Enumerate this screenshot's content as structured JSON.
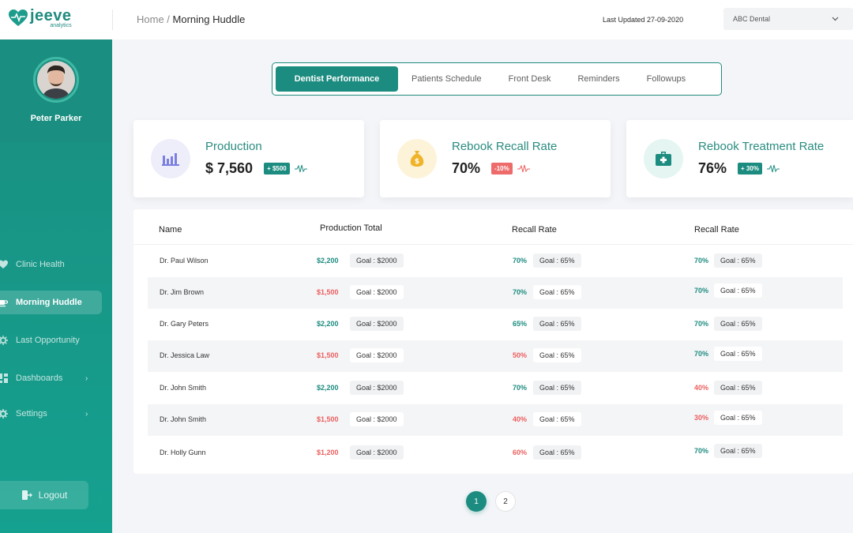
{
  "brand": {
    "name": "jeeve",
    "sub": "analytics",
    "accent": "#1d8c80"
  },
  "breadcrumb": {
    "home": "Home",
    "separator": " / ",
    "current": "Morning Huddle"
  },
  "header": {
    "last_updated": "Last Updated 27-09-2020",
    "clinic": "ABC Dental",
    "clinic_icon": "chevron-down-icon"
  },
  "profile": {
    "name": "Peter Parker"
  },
  "sidebar": {
    "items": [
      {
        "label": "Clinic Health",
        "icon": "heart-pulse-icon"
      },
      {
        "label": "Morning Huddle",
        "icon": "coffee-icon",
        "active": true
      },
      {
        "label": "Last Opportunity",
        "icon": "gear-icon"
      },
      {
        "label": "Dashboards",
        "icon": "dashboard-icon",
        "arrow": "›"
      },
      {
        "label": "Settings",
        "icon": "settings-icon",
        "arrow": "›"
      }
    ],
    "logout": "Logout"
  },
  "tabs": [
    {
      "label": "Dentist Performance",
      "active": true
    },
    {
      "label": "Patients Schedule"
    },
    {
      "label": "Front Desk"
    },
    {
      "label": "Reminders"
    },
    {
      "label": "Followups"
    }
  ],
  "cards": [
    {
      "title": "Production",
      "value": "$ 7,560",
      "badge": "+ $500",
      "trend": "up",
      "icon": "bar-chart-icon",
      "color": "#7b7fe0",
      "bg": "#eeeefb"
    },
    {
      "title": "Rebook Recall Rate",
      "value": "70%",
      "badge": "-10%",
      "trend": "down",
      "icon": "money-bag-icon",
      "color": "#f0b429",
      "bg": "#fdf3d9"
    },
    {
      "title": "Rebook Treatment Rate",
      "value": "76%",
      "badge": "+ 30%",
      "trend": "up",
      "icon": "medkit-icon",
      "color": "#1d8c80",
      "bg": "#e4f5f2"
    }
  ],
  "table": {
    "headers": [
      "Name",
      "Production Total",
      "Recall Rate",
      "Recall Rate"
    ],
    "rows": [
      {
        "name": "Dr. Paul Wilson",
        "prod": "$2,200",
        "prod_ok": true,
        "prod_goal": "Goal : $2000",
        "recall": "70%",
        "recall_ok": true,
        "recall_goal": "Goal : 65%",
        "recall2": "70%",
        "recall2_ok": true,
        "recall2_goal": "Goal : 65%"
      },
      {
        "name": "Dr. Jim Brown",
        "prod": "$1,500",
        "prod_ok": false,
        "prod_goal": "Goal : $2000",
        "recall": "70%",
        "recall_ok": true,
        "recall_goal": "Goal : 65%",
        "recall2": "70%",
        "recall2_ok": true,
        "recall2_goal": "Goal : 65%"
      },
      {
        "name": "Dr. Gary Peters",
        "prod": "$2,200",
        "prod_ok": true,
        "prod_goal": "Goal : $2000",
        "recall": "65%",
        "recall_ok": true,
        "recall_goal": "Goal : 65%",
        "recall2": "70%",
        "recall2_ok": true,
        "recall2_goal": "Goal : 65%"
      },
      {
        "name": "Dr. Jessica Law",
        "prod": "$1,500",
        "prod_ok": false,
        "prod_goal": "Goal : $2000",
        "recall": "50%",
        "recall_ok": false,
        "recall_goal": "Goal : 65%",
        "recall2": "70%",
        "recall2_ok": true,
        "recall2_goal": "Goal : 65%"
      },
      {
        "name": "Dr. John Smith",
        "prod": "$2,200",
        "prod_ok": true,
        "prod_goal": "Goal : $2000",
        "recall": "70%",
        "recall_ok": true,
        "recall_goal": "Goal : 65%",
        "recall2": "40%",
        "recall2_ok": false,
        "recall2_goal": "Goal : 65%"
      },
      {
        "name": "Dr. John Smith",
        "prod": "$1,500",
        "prod_ok": false,
        "prod_goal": "Goal : $2000",
        "recall": "40%",
        "recall_ok": false,
        "recall_goal": "Goal : 65%",
        "recall2": "30%",
        "recall2_ok": false,
        "recall2_goal": "Goal : 65%"
      },
      {
        "name": "Dr. Holly Gunn",
        "prod": "$1,200",
        "prod_ok": false,
        "prod_goal": "Goal : $2000",
        "recall": "60%",
        "recall_ok": false,
        "recall_goal": "Goal : 65%",
        "recall2": "70%",
        "recall2_ok": true,
        "recall2_goal": "Goal : 65%"
      }
    ]
  },
  "pagination": {
    "pages": [
      "1",
      "2"
    ],
    "current": "1"
  }
}
